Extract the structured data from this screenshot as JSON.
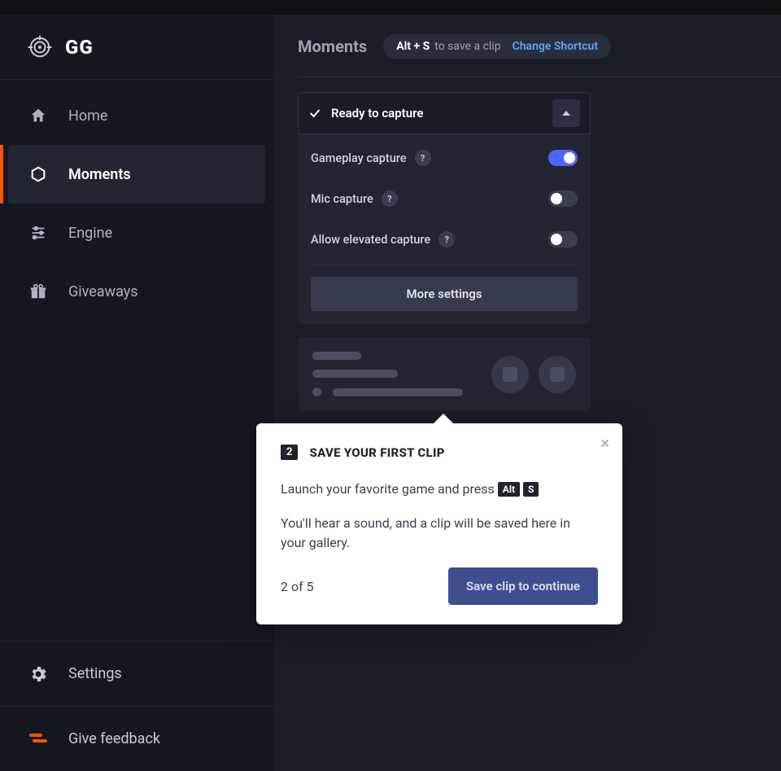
{
  "brand": {
    "name": "GG"
  },
  "nav": {
    "home": {
      "label": "Home"
    },
    "moments": {
      "label": "Moments"
    },
    "engine": {
      "label": "Engine"
    },
    "giveaways": {
      "label": "Giveaways"
    }
  },
  "sidebar_bottom": {
    "settings": {
      "label": "Settings"
    },
    "feedback": {
      "label": "Give feedback"
    }
  },
  "header": {
    "title": "Moments",
    "shortcut_keys": "Alt + S",
    "shortcut_desc": "to save a clip",
    "change_link": "Change Shortcut"
  },
  "capture_panel": {
    "status": "Ready to capture",
    "gameplay": {
      "label": "Gameplay capture",
      "on": true
    },
    "mic": {
      "label": "Mic capture",
      "on": false
    },
    "elevated": {
      "label": "Allow elevated capture",
      "on": false
    },
    "more_btn": "More settings"
  },
  "tour": {
    "step": "2",
    "title": "SAVE YOUR FIRST CLIP",
    "line1_prefix": "Launch your favorite game and press ",
    "key1": "Alt",
    "key2": "S",
    "line2": "You'll hear a sound, and a clip will be saved here in your gallery.",
    "progress": "2 of 5",
    "cta": "Save clip to continue"
  }
}
